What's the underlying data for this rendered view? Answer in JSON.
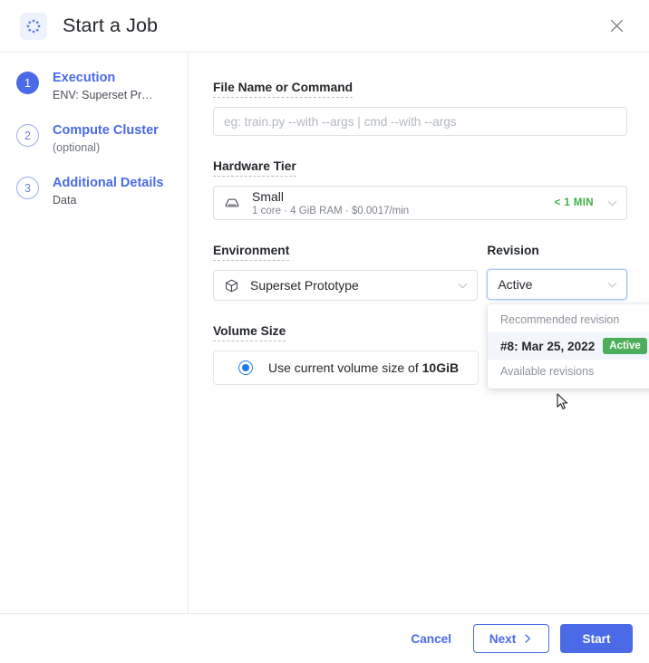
{
  "header": {
    "title": "Start a Job",
    "icon": "job-spinner-icon",
    "close_icon": "close-icon"
  },
  "sidebar": {
    "steps": [
      {
        "number": "1",
        "title": "Execution",
        "subtitle": "ENV: Superset Pr…",
        "state": "active"
      },
      {
        "number": "2",
        "title": "Compute Cluster",
        "subtitle": "(optional)",
        "state": "inactive"
      },
      {
        "number": "3",
        "title": "Additional Details",
        "subtitle": "Data",
        "state": "inactive"
      }
    ]
  },
  "form": {
    "file_command": {
      "label": "File Name or Command",
      "placeholder": "eg: train.py --with --args | cmd --with --args",
      "value": ""
    },
    "hardware_tier": {
      "label": "Hardware Tier",
      "icon": "hard-drive-icon",
      "name": "Small",
      "spec": "1 core · 4 GiB RAM · $0.0017/min",
      "eta": "< 1 MIN",
      "eta_color": "#3bb143",
      "chevron": "chevron-down-icon"
    },
    "environment": {
      "label": "Environment",
      "icon": "cube-icon",
      "value": "Superset Prototype",
      "chevron": "chevron-down-icon"
    },
    "revision": {
      "label": "Revision",
      "value": "Active",
      "chevron": "chevron-down-icon",
      "open": true,
      "groups": [
        {
          "header": "Recommended revision",
          "items": [
            {
              "label": "#8: Mar 25, 2022",
              "badge": "Active",
              "badge_color": "#4cae5a",
              "hovered": true
            }
          ]
        },
        {
          "header": "Available revisions",
          "items": []
        }
      ]
    },
    "volume_size": {
      "label": "Volume Size",
      "option_prefix": "Use current volume size of ",
      "option_value": "10GiB",
      "selected": true
    }
  },
  "footer": {
    "cancel_label": "Cancel",
    "next_label": "Next",
    "next_icon": "chevron-right-icon",
    "start_label": "Start"
  },
  "colors": {
    "accent": "#4a6ae8",
    "success": "#3bb143",
    "badge": "#4cae5a",
    "radio": "#1b7fe3"
  }
}
